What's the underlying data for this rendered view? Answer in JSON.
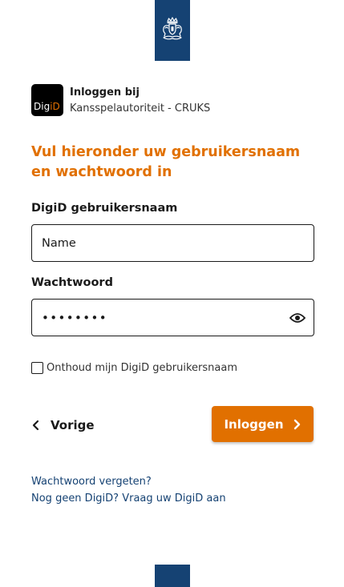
{
  "header": {
    "emblem_icon": "rijksoverheid-coat-of-arms-icon",
    "brand_color": "#154273"
  },
  "service": {
    "logo_text_prefix": "Dig",
    "logo_text_accent": "iD",
    "login_at": "Inloggen bij",
    "name": "Kansspelautoriteit - CRUKS"
  },
  "form": {
    "heading": "Vul hieronder uw gebruikersnaam en wachtwoord in",
    "username_label": "DigiD gebruikersnaam",
    "username_value": "Name",
    "password_label": "Wachtwoord",
    "password_value": "••••••••",
    "show_password_icon": "eye-icon",
    "remember_label": "Onthoud mijn DigiD gebruikersnaam",
    "remember_checked": false
  },
  "actions": {
    "back_label": "Vorige",
    "login_label": "Inloggen"
  },
  "links": {
    "forgot_password": "Wachtwoord vergeten?",
    "request_digid": "Nog geen DigiD? Vraag uw DigiD aan"
  },
  "colors": {
    "accent": "#e17000",
    "brand_blue": "#154273",
    "text": "#1a1a1a"
  }
}
